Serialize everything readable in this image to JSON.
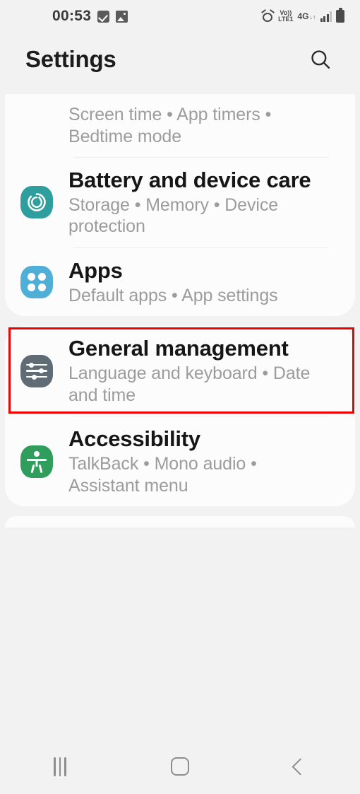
{
  "status_bar": {
    "time": "00:53",
    "left_icons": [
      "checkbox-icon",
      "photo-icon"
    ],
    "network_label": "4G",
    "volte_top": "Vo))",
    "volte_bottom": "LTE1",
    "data_arrows": "↓↑",
    "right_icons": [
      "alarm-icon",
      "volte-icon",
      "network-icon",
      "signal-bars-icon",
      "battery-icon"
    ]
  },
  "app_bar": {
    "title": "Settings",
    "search_icon": "search-icon"
  },
  "cards": [
    {
      "clipped_top": true,
      "rows": [
        {
          "title": "",
          "subtitle": "Screen time • App timers • Bedtime mode",
          "icon": "digital-wellbeing-icon",
          "icon_color": "",
          "has_divider": true
        },
        {
          "title": "Battery and device care",
          "subtitle": "Storage • Memory • Device protection",
          "icon": "battery-device-care-icon",
          "icon_color": "#2f9e9e",
          "has_divider": true
        },
        {
          "title": "Apps",
          "subtitle": "Default apps • App settings",
          "icon": "apps-icon",
          "icon_color": "#4fafd6",
          "has_divider": false,
          "highlighted": true
        }
      ]
    },
    {
      "clipped_top": false,
      "rows": [
        {
          "title": "General management",
          "subtitle": "Language and keyboard • Date and time",
          "icon": "general-management-icon",
          "icon_color": "#5f6c75",
          "has_divider": true
        },
        {
          "title": "Accessibility",
          "subtitle": "TalkBack • Mono audio • Assistant menu",
          "icon": "accessibility-icon",
          "icon_color": "#2f9e5c",
          "has_divider": false
        }
      ]
    }
  ],
  "annotation": {
    "color": "#ef0000",
    "target": "Apps"
  },
  "nav_bar": {
    "recents_label": "recents-icon",
    "home_label": "home-icon",
    "back_label": "back-icon"
  }
}
